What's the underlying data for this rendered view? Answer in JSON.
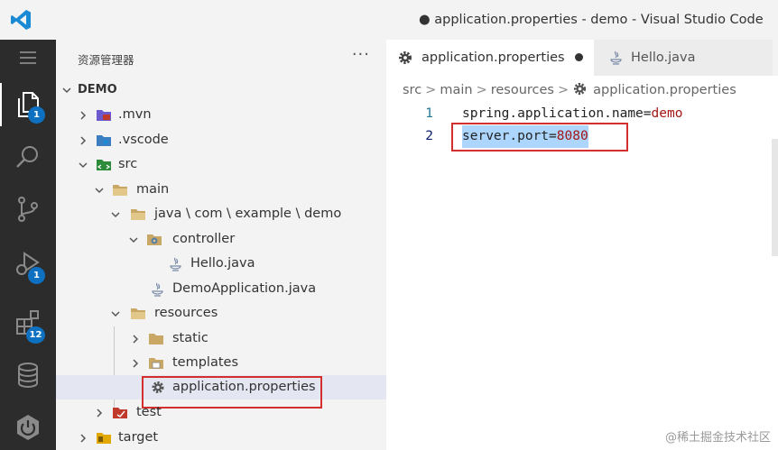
{
  "window": {
    "title": "● application.properties - demo - Visual Studio Code"
  },
  "activity_bar": {
    "items": [
      {
        "name": "menu",
        "icon": "hamburger-menu-icon"
      },
      {
        "name": "explorer",
        "icon": "files-icon",
        "badge": "1"
      },
      {
        "name": "search",
        "icon": "search-icon"
      },
      {
        "name": "source-control",
        "icon": "source-control-icon"
      },
      {
        "name": "run-debug",
        "icon": "run-debug-icon",
        "badge": "1"
      },
      {
        "name": "extensions",
        "icon": "extensions-icon",
        "badge": "12"
      },
      {
        "name": "database",
        "icon": "database-icon"
      },
      {
        "name": "spring-boot",
        "icon": "spring-boot-icon"
      }
    ]
  },
  "sidebar": {
    "title": "资源管理器",
    "more": "···",
    "tree": [
      {
        "label": "DEMO",
        "icon": "",
        "chevron": "down"
      },
      {
        "label": ".mvn",
        "icon": "mvn-folder-icon",
        "chevron": "right"
      },
      {
        "label": ".vscode",
        "icon": "vscode-folder-icon",
        "chevron": "right"
      },
      {
        "label": "src",
        "icon": "src-folder-icon",
        "chevron": "down"
      },
      {
        "label": "main",
        "icon": "folder-open-icon",
        "chevron": "down"
      },
      {
        "label": "java \\ com \\ example \\ demo",
        "icon": "folder-open-icon",
        "chevron": "down"
      },
      {
        "label": "controller",
        "icon": "controller-folder-icon",
        "chevron": "down"
      },
      {
        "label": "Hello.java",
        "icon": "java-file-icon",
        "chevron": ""
      },
      {
        "label": "DemoApplication.java",
        "icon": "java-file-icon",
        "chevron": ""
      },
      {
        "label": "resources",
        "icon": "folder-open-icon",
        "chevron": "down"
      },
      {
        "label": "static",
        "icon": "folder-icon",
        "chevron": "right"
      },
      {
        "label": "templates",
        "icon": "templates-folder-icon",
        "chevron": "right"
      },
      {
        "label": "application.properties",
        "icon": "gear-icon",
        "chevron": "",
        "selected": true
      },
      {
        "label": "test",
        "icon": "test-folder-icon",
        "chevron": "right"
      },
      {
        "label": "target",
        "icon": "target-folder-icon",
        "chevron": "right"
      }
    ]
  },
  "editor": {
    "tabs": [
      {
        "label": "application.properties",
        "icon": "gear-icon",
        "modified": true,
        "active": true
      },
      {
        "label": "Hello.java",
        "icon": "java-file-icon",
        "modified": false,
        "active": false
      }
    ],
    "breadcrumb": [
      "src",
      "main",
      "resources",
      "application.properties"
    ],
    "lines": [
      {
        "number": "1",
        "key": "spring.application.name",
        "eq": "=",
        "value": "demo"
      },
      {
        "number": "2",
        "key": "server.port",
        "eq": "=",
        "value": "8080"
      }
    ]
  },
  "watermark": "@稀土掘金技术社区",
  "colors": {
    "activity_bg": "#2c2c2c",
    "sidebar_bg": "#f3f3f3",
    "badge": "#0e70c0",
    "highlight_box": "#d32f2f",
    "selection": "#add6ff",
    "value_text": "#a31515"
  }
}
